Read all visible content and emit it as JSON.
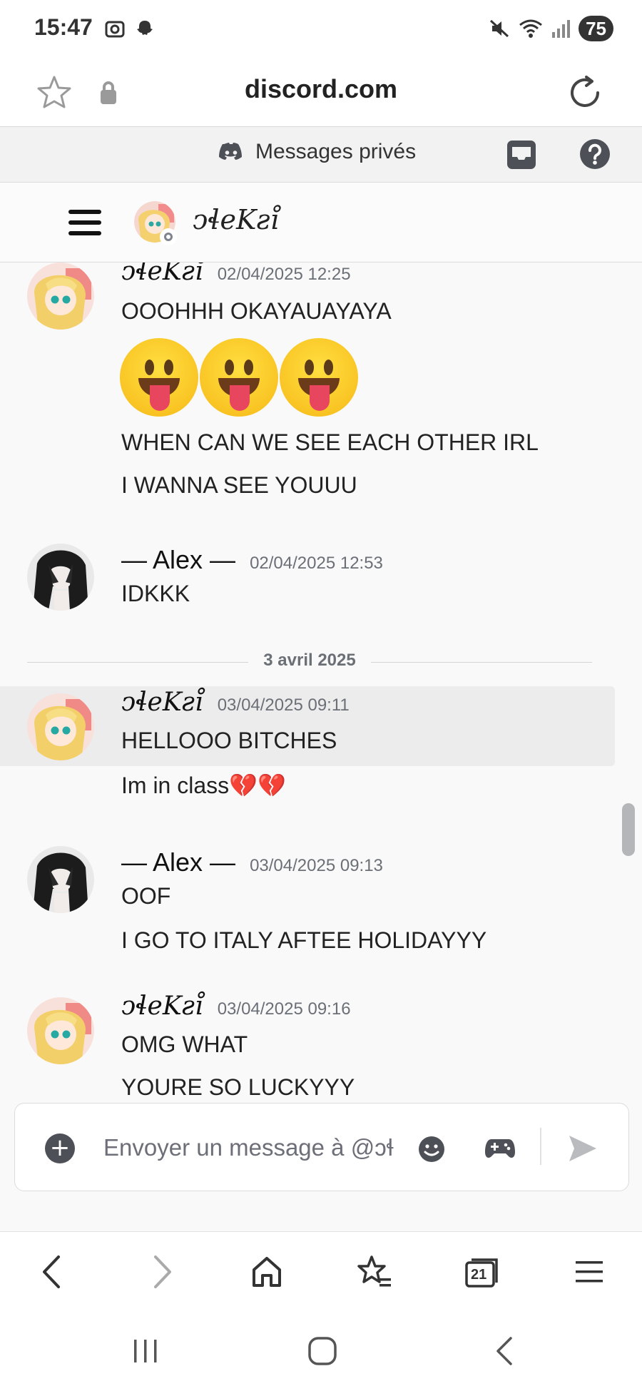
{
  "status_bar": {
    "time": "15:47",
    "battery": "75"
  },
  "browser": {
    "url": "discord.com",
    "tabs_count": "21"
  },
  "discord": {
    "section_title": "Messages privés",
    "channel_name": "ↄɬeKƨi̊"
  },
  "messages": [
    {
      "author": "ↄɬeKƨi̊",
      "timestamp": "02/04/2025 12:25",
      "lines": [
        "OOOHHH OKAYAUAYAYA",
        "WHEN CAN WE SEE EACH OTHER IRL",
        "I WANNA SEE YOUUU"
      ],
      "emoji": [
        "stuck-out-tongue-face",
        "stuck-out-tongue-face",
        "stuck-out-tongue-face"
      ]
    },
    {
      "author": "— Alex —",
      "timestamp": "02/04/2025 12:53",
      "lines": [
        "IDKKK"
      ]
    },
    {
      "author": "ↄɬeKƨi̊",
      "timestamp": "03/04/2025 09:11",
      "lines": [
        "HELLOOO BITCHES",
        "Im in class💔💔"
      ]
    },
    {
      "author": "— Alex —",
      "timestamp": "03/04/2025 09:13",
      "lines": [
        "OOF",
        "I GO TO ITALY AFTEE HOLIDAYYY"
      ]
    },
    {
      "author": "ↄɬeKƨi̊",
      "timestamp": "03/04/2025 09:16",
      "lines": [
        "OMG WHAT",
        "YOURE SO LUCKYYY"
      ]
    }
  ],
  "date_divider": "3 avril 2025",
  "composer": {
    "placeholder": "Envoyer un message à @ↄɬ"
  },
  "colors": {
    "discord_grey": "#4e5058",
    "background": "#f9f9fa",
    "highlight": "#ececed"
  }
}
